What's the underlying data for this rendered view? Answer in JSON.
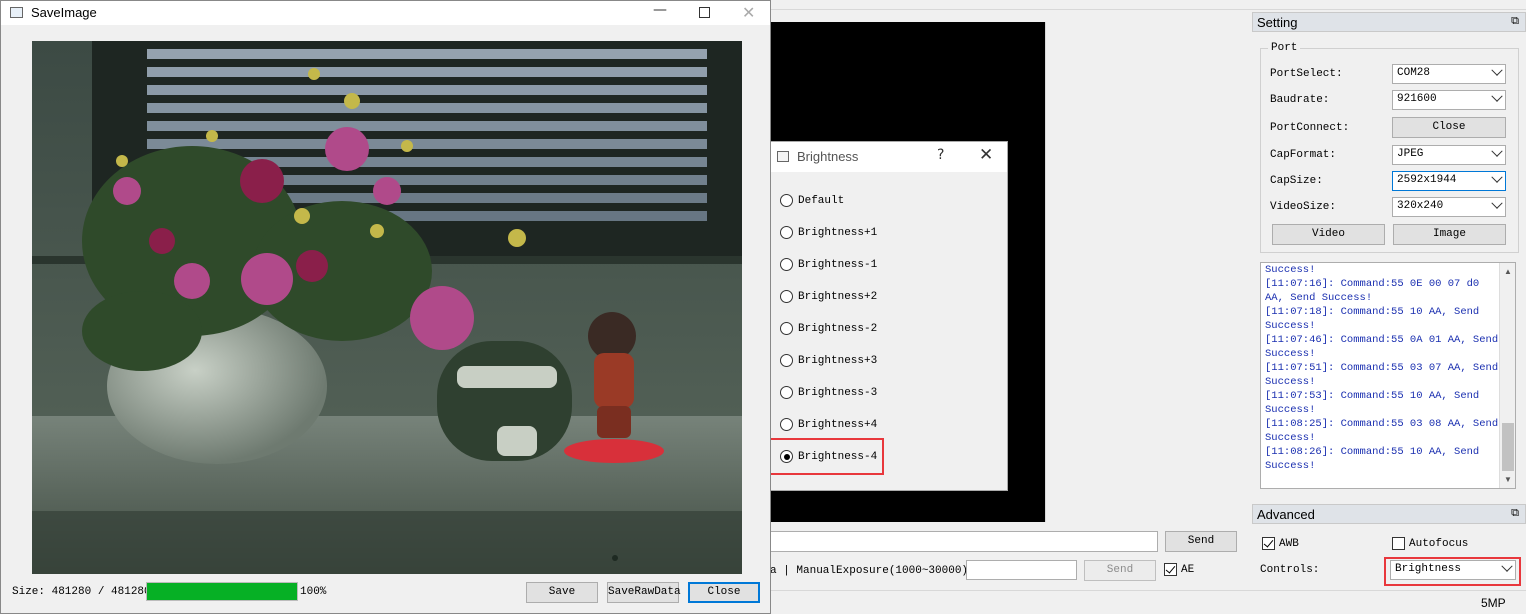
{
  "save_window": {
    "title": "SaveImage",
    "size_label": "Size: 481280 / 481280",
    "progress": 1.0,
    "progress_text": "100%",
    "buttons": {
      "save": "Save",
      "save_raw": "SaveRawData",
      "close": "Close"
    }
  },
  "brightness_dialog": {
    "title": "Brightness",
    "help": "?",
    "options": [
      "Default",
      "Brightness+1",
      "Brightness-1",
      "Brightness+2",
      "Brightness-2",
      "Brightness+3",
      "Brightness-3",
      "Brightness+4",
      "Brightness-4"
    ],
    "selected": "Brightness-4"
  },
  "setting": {
    "title": "Setting",
    "group": "Port",
    "port_select_label": "PortSelect:",
    "port_select_value": "COM28",
    "baudrate_label": "Baudrate:",
    "baudrate_value": "921600",
    "port_connect_label": "PortConnect:",
    "port_connect_button": "Close",
    "cap_format_label": "CapFormat:",
    "cap_format_value": "JPEG",
    "cap_size_label": "CapSize:",
    "cap_size_value": "2592x1944",
    "video_size_label": "VideoSize:",
    "video_size_value": "320x240",
    "video_button": "Video",
    "image_button": "Image"
  },
  "log": {
    "lines": [
      "Success!",
      "[11:07:16]: Command:55 0E 00 07 d0 AA, Send Success!",
      "[11:07:18]: Command:55 10 AA, Send Success!",
      "[11:07:46]: Command:55 0A 01 AA, Send Success!",
      "[11:07:51]: Command:55 03 07 AA, Send Success!",
      "[11:07:53]: Command:55 10 AA, Send Success!",
      "[11:08:25]: Command:55 03 08 AA, Send Success!",
      "[11:08:26]: Command:55 10 AA, Send Success!"
    ]
  },
  "advanced": {
    "title": "Advanced",
    "awb_label": "AWB",
    "awb_checked": true,
    "autofocus_label": "Autofocus",
    "autofocus_checked": false,
    "controls_label": "Controls:",
    "controls_value": "Brightness"
  },
  "command_bar": {
    "send_label": "Send",
    "manual_exposure_label": "a  |  ManualExposure(1000~30000):",
    "exposure_send_label": "Send",
    "ae_label": "AE",
    "ae_checked": true
  },
  "status": {
    "resolution": "5MP"
  },
  "colors": {
    "accent": "#0078d7",
    "highlight": "#e8373c",
    "progress": "#06b025",
    "log_text": "#1a2fb0"
  }
}
